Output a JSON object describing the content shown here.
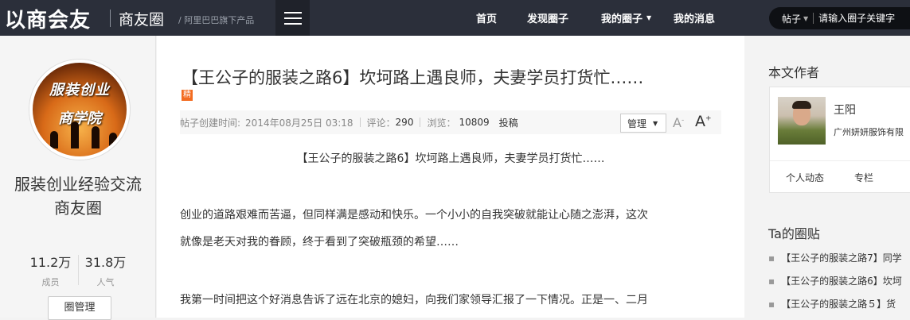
{
  "header": {
    "brand": "以商会友",
    "subbrand": "商友圈",
    "tagline": "/ 阿里巴巴旗下产品",
    "nav": [
      "首页",
      "发现圈子",
      "我的圈子",
      "我的消息"
    ],
    "search": {
      "scope": "帖子",
      "placeholder": "请输入圈子关键字"
    }
  },
  "group": {
    "avatar_line1": "服装创业",
    "avatar_line2": "商学院",
    "name": "服装创业经验交流商友圈",
    "stats": [
      {
        "value": "11.2万",
        "label": "成员"
      },
      {
        "value": "31.8万",
        "label": "人气"
      }
    ],
    "manage_label": "圈管理"
  },
  "article": {
    "title": "【王公子的服装之路6】坎坷路上遇良师，夫妻学员打货忙……",
    "badge": "精",
    "meta": {
      "created_label": "帖子创建时间:",
      "created_value": "2014年08月25日 03:18",
      "comments_label": "评论：",
      "comments_value": "290",
      "views_label": "浏览：",
      "views_value": "10809",
      "report": "投稿"
    },
    "manage_select": "管理",
    "font_small": "A",
    "font_small_sup": "-",
    "font_large": "A",
    "font_large_sup": "+",
    "heading": "【王公子的服装之路6】坎坷路上遇良师，夫妻学员打货忙……",
    "paragraph1_line1": "创业的道路艰难而苦逼，但同样满是感动和快乐。一个小小的自我突破就能让心随之澎湃，这次",
    "paragraph1_line2": "就像是老天对我的眷顾，终于看到了突破瓶颈的希望……",
    "paragraph2_line1": "我第一时间把这个好消息告诉了远在北京的媳妇，向我们家领导汇报了一下情况。正是一、二月"
  },
  "sidebar": {
    "author_title": "本文作者",
    "author_name": "王阳",
    "author_company": "广州妍妍服饰有限",
    "author_tabs": [
      "个人动态",
      "专栏"
    ],
    "posts_title": "Ta的圈贴",
    "posts": [
      "【王公子的服装之路7】同学",
      "【王公子的服装之路6】坎坷",
      "【王公子的服装之路５】货"
    ]
  }
}
